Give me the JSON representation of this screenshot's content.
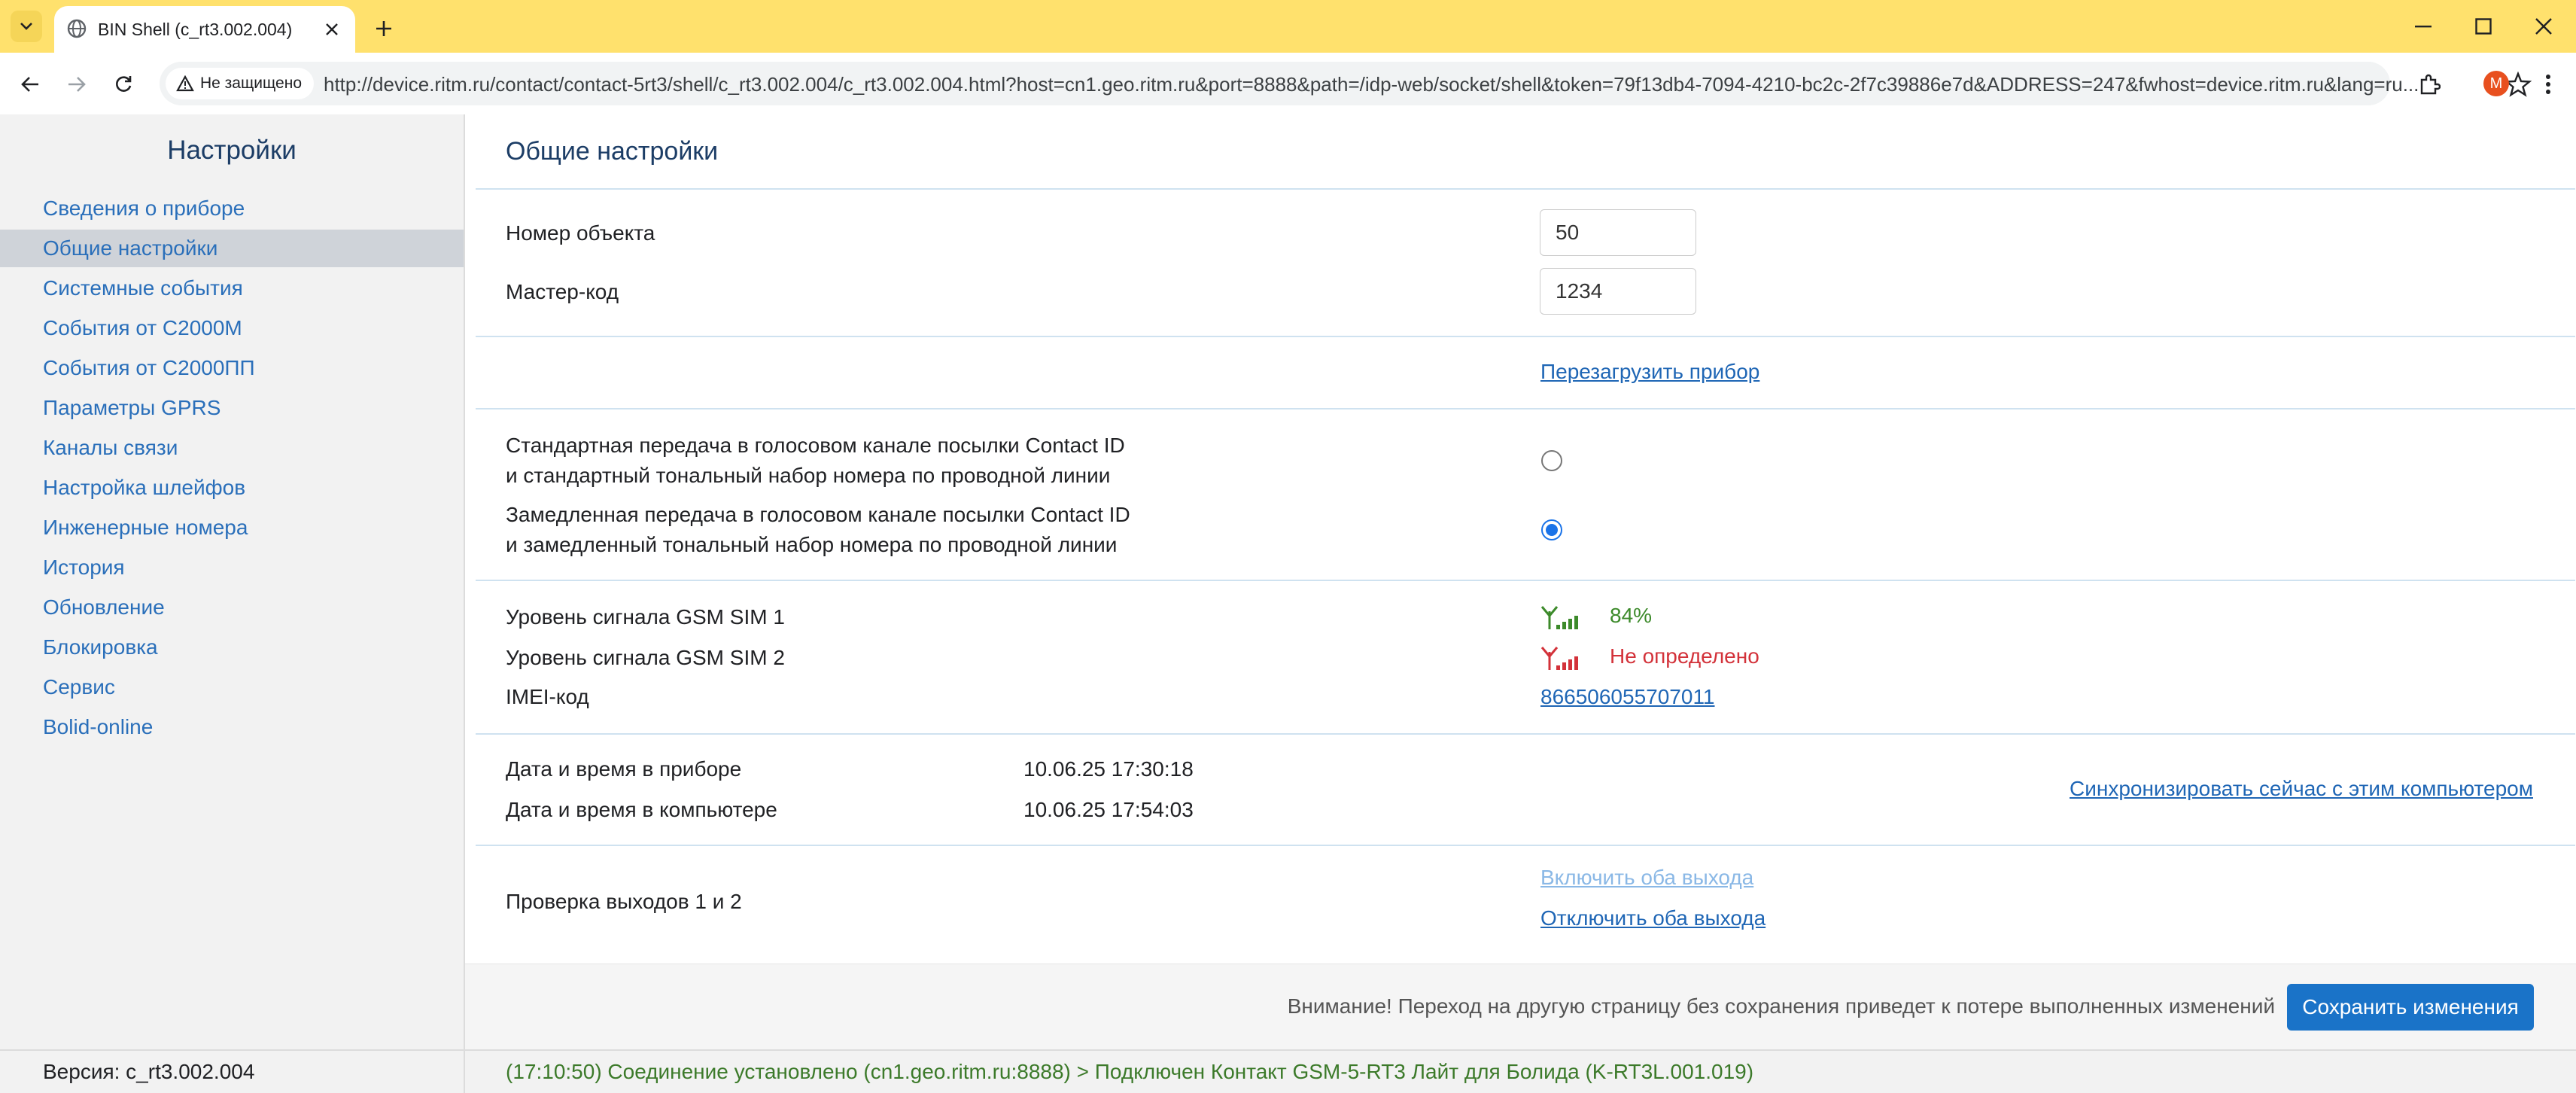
{
  "browser": {
    "tab_title": "BIN Shell (c_rt3.002.004)",
    "security_label": "Не защищено",
    "url": "http://device.ritm.ru/contact/contact-5rt3/shell/c_rt3.002.004/c_rt3.002.004.html?host=cn1.geo.ritm.ru&port=8888&path=/idp-web/socket/shell&token=79f13db4-7094-4210-bc2c-2f7c39886e7d&ADDRESS=247&fwhost=device.ritm.ru&lang=ru...",
    "avatar_letter": "M",
    "accent_color": "#ffe16d"
  },
  "sidebar": {
    "title": "Настройки",
    "items": [
      {
        "label": "Сведения о приборе",
        "active": false
      },
      {
        "label": "Общие настройки",
        "active": true
      },
      {
        "label": "Системные события",
        "active": false
      },
      {
        "label": "События от С2000М",
        "active": false
      },
      {
        "label": "События от С2000ПП",
        "active": false
      },
      {
        "label": "Параметры GPRS",
        "active": false
      },
      {
        "label": "Каналы связи",
        "active": false
      },
      {
        "label": "Настройка шлейфов",
        "active": false
      },
      {
        "label": "Инженерные номера",
        "active": false
      },
      {
        "label": "История",
        "active": false
      },
      {
        "label": "Обновление",
        "active": false
      },
      {
        "label": "Блокировка",
        "active": false
      },
      {
        "label": "Сервис",
        "active": false
      },
      {
        "label": "Bolid-online",
        "active": false
      }
    ]
  },
  "main": {
    "title": "Общие настройки",
    "object_number": {
      "label": "Номер объекта",
      "value": "50"
    },
    "master_code": {
      "label": "Мастер-код",
      "value": "1234"
    },
    "reboot_link": "Перезагрузить прибор",
    "transfer_mode": {
      "standard": {
        "line1": "Стандартная передача в голосовом канале посылки Contact ID",
        "line2": "и стандартный тональный набор номера по проводной линии",
        "selected": false
      },
      "delayed": {
        "line1": "Замедленная передача в голосовом канале посылки Contact ID",
        "line2": "и замедленный тональный набор номера по проводной линии",
        "selected": true
      }
    },
    "gsm_sim1": {
      "label": "Уровень сигнала GSM SIM 1",
      "value": "84%",
      "color": "#3c8a2a"
    },
    "gsm_sim2": {
      "label": "Уровень сигнала GSM SIM 2",
      "value": "Не определено",
      "color": "#d3323a"
    },
    "imei": {
      "label": "IMEI-код",
      "value": "866506055707011"
    },
    "device_time": {
      "label": "Дата и время в приборе",
      "value": "10.06.25 17:30:18"
    },
    "computer_time": {
      "label": "Дата и время в компьютере",
      "value": "10.06.25 17:54:03"
    },
    "sync_link": "Синхронизировать сейчас с этим компьютером",
    "outputs": {
      "label": "Проверка выходов 1 и 2",
      "enable_link": "Включить оба выхода",
      "disable_link": "Отключить оба выхода"
    },
    "warning": "Внимание! Переход на другую страницу без сохранения приведет к потере выполненных изменений",
    "save_button": "Сохранить изменения"
  },
  "status": {
    "version": "Версия: c_rt3.002.004",
    "connection": "(17:10:50) Соединение установлено (cn1.geo.ritm.ru:8888) > Подключен Контакт GSM-5-RT3 Лайт для Болида (K-RT3L.001.019)"
  }
}
